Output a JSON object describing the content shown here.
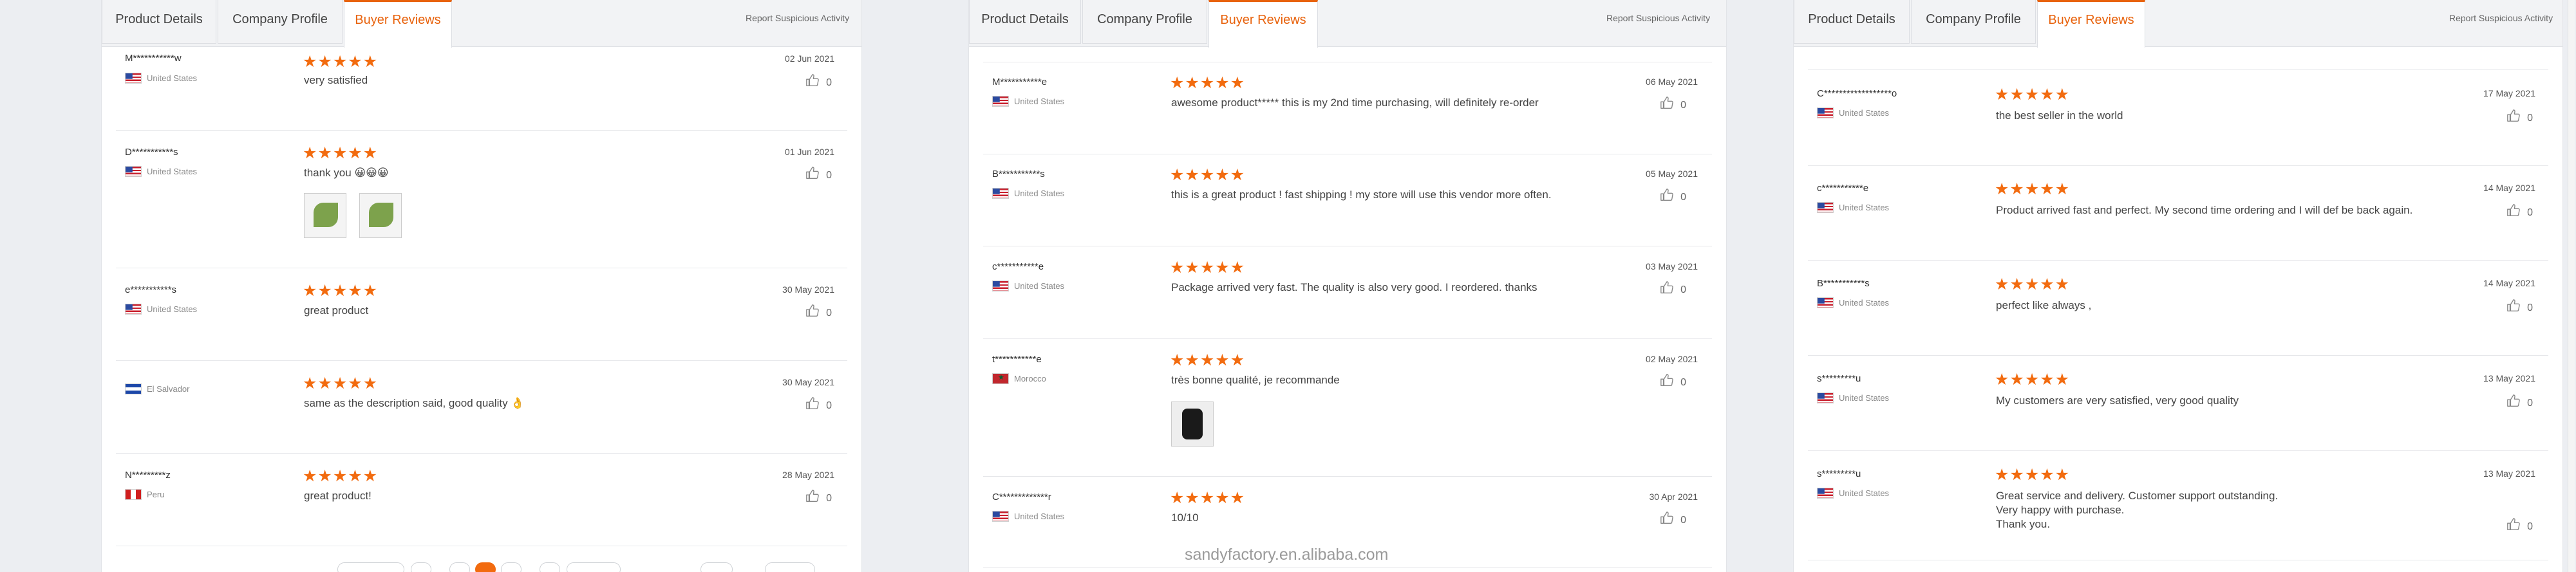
{
  "tabs": [
    "Product Details",
    "Company Profile",
    "Buyer Reviews"
  ],
  "report_label": "Report Suspicious Activity",
  "watermark": "sandyfactory.en.alibaba.com",
  "stars": "★★★★★",
  "icons": {
    "like": "thumbs-up-icon"
  },
  "colors": {
    "accent": "#e8620c",
    "star": "#f26b0f"
  },
  "panel1": {
    "reviews": [
      {
        "name": "M***********w",
        "country": "United States",
        "date": "02 Jun 2021",
        "text": "very satisfied",
        "likes": "0"
      },
      {
        "name": "D***********s",
        "country": "United States",
        "date": "01 Jun 2021",
        "text": "thank you 😀😀😀",
        "likes": "0"
      },
      {
        "name": "e***********s",
        "country": "United States",
        "date": "30 May 2021",
        "text": "great product",
        "likes": "0"
      },
      {
        "name": "",
        "country": "El Salvador",
        "date": "30 May 2021",
        "text": "same as the description said, good quality 👌",
        "likes": "0"
      },
      {
        "name": "N*********z",
        "country": "Peru",
        "date": "28 May 2021",
        "text": "great product!",
        "likes": "0"
      }
    ]
  },
  "panel2": {
    "reviews": [
      {
        "name": "M***********e",
        "country": "United States",
        "date": "06 May 2021",
        "text": "awesome product***** this is my 2nd time purchasing, will definitely re-order",
        "likes": "0"
      },
      {
        "name": "B***********s",
        "country": "United States",
        "date": "05 May 2021",
        "text": "this is a great product ! fast shipping ! my store will use this vendor more often.",
        "likes": "0"
      },
      {
        "name": "c***********e",
        "country": "United States",
        "date": "03 May 2021",
        "text": "Package arrived very fast. The quality is also very good. I reordered. thanks",
        "likes": "0"
      },
      {
        "name": "t***********e",
        "country": "Morocco",
        "date": "02 May 2021",
        "text": "très bonne qualité, je recommande",
        "likes": "0"
      },
      {
        "name": "C*************r",
        "country": "United States",
        "date": "30 Apr 2021",
        "text": "10/10",
        "likes": "0"
      }
    ]
  },
  "panel3": {
    "reviews": [
      {
        "name": "C******************o",
        "country": "United States",
        "date": "17 May 2021",
        "text": "the best seller in the world",
        "likes": "0"
      },
      {
        "name": "c***********e",
        "country": "United States",
        "date": "14 May 2021",
        "text": "Product arrived fast and perfect. My second time ordering and I will def be back again.",
        "likes": "0"
      },
      {
        "name": "B***********s",
        "country": "United States",
        "date": "14 May 2021",
        "text": "perfect like always ,",
        "likes": "0"
      },
      {
        "name": "s*********u",
        "country": "United States",
        "date": "13 May 2021",
        "text": "My customers are very satisfied, very good quality",
        "likes": "0"
      },
      {
        "name": "s*********u",
        "country": "United States",
        "date": "13 May 2021",
        "text_lines": [
          "Great service and delivery. Customer support outstanding.",
          "Very happy with purchase.",
          "Thank you."
        ],
        "likes": "0"
      }
    ]
  }
}
